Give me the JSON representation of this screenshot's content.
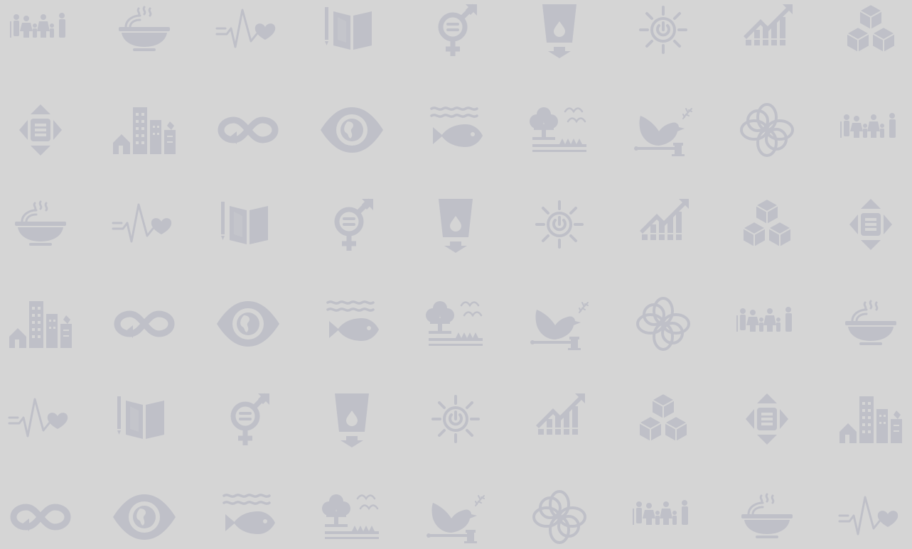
{
  "background_color": "#d5d5d5",
  "icon_color": "#bfc0c8",
  "icon_sequence": [
    "people-icon",
    "bowl-icon",
    "health-icon",
    "education-icon",
    "gender-icon",
    "water-icon",
    "energy-icon",
    "growth-icon",
    "cubes-icon",
    "equality-icon",
    "city-icon",
    "infinity-icon",
    "eye-icon",
    "fish-icon",
    "land-icon",
    "dove-icon",
    "flower-icon"
  ]
}
